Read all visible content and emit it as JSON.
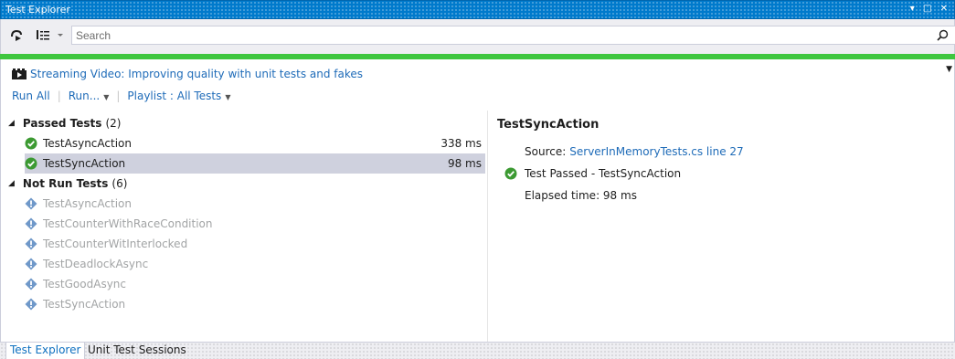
{
  "window": {
    "title": "Test Explorer",
    "controls_glyph": "▾ □ ✕"
  },
  "toolbar": {
    "search_placeholder": "Search",
    "icons": [
      "pin-icon",
      "group-by-icon",
      "dropdown-chevron-icon",
      "search-icon"
    ]
  },
  "progress": {
    "state": "passed",
    "color": "#3ec63e",
    "fraction": 1.0
  },
  "streaming": {
    "label": "Streaming Video: Improving quality with unit tests and fakes",
    "overflow_glyph": "▼"
  },
  "actions": {
    "run_all": "Run All",
    "run": "Run...",
    "playlist": "Playlist : All Tests"
  },
  "groups": {
    "passed": {
      "name": "Passed Tests",
      "count": "(2)",
      "items": [
        {
          "name": "TestAsyncAction",
          "duration": "338 ms"
        },
        {
          "name": "TestSyncAction",
          "duration": "98 ms",
          "selected": true
        }
      ]
    },
    "notrun": {
      "name": "Not Run Tests",
      "count": "(6)",
      "items": [
        {
          "name": "TestAsyncAction"
        },
        {
          "name": "TestCounterWithRaceCondition"
        },
        {
          "name": "TestCounterWitInterlocked"
        },
        {
          "name": "TestDeadlockAsync"
        },
        {
          "name": "TestGoodAsync"
        },
        {
          "name": "TestSyncAction"
        }
      ]
    }
  },
  "details": {
    "title": "TestSyncAction",
    "source_label": "Source:",
    "source_link": "ServerInMemoryTests.cs line 27",
    "status": "Test Passed - TestSyncAction",
    "elapsed": "Elapsed time: 98 ms"
  },
  "bottom_tabs": [
    "Test Explorer",
    "Unit Test Sessions"
  ],
  "colors": {
    "accent": "#007acc",
    "link": "#1e6bb8",
    "pass": "#3c9a32",
    "not_run": "#6f98c9",
    "selection": "#cfd1de"
  }
}
